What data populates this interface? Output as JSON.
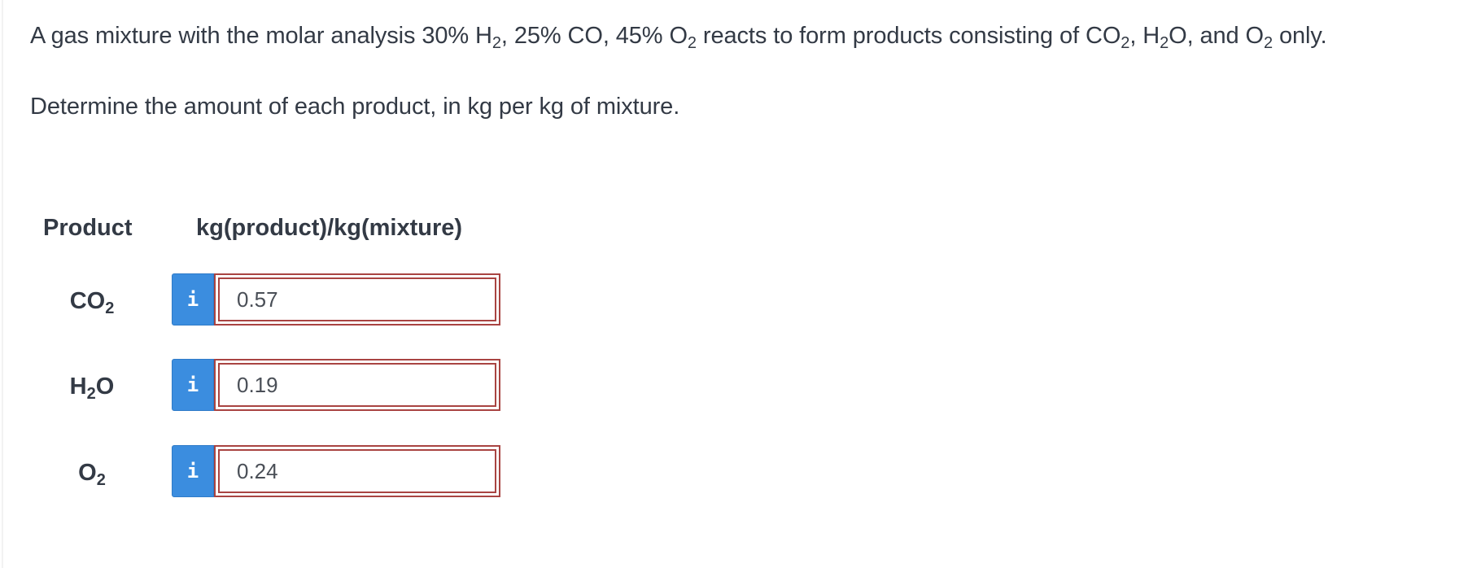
{
  "question": {
    "line1": {
      "intro": "A gas mixture with the molar analysis 30% H",
      "h2_sub": "2",
      "after_h2": ", 25% CO, 45% O",
      "o2_sub": "2",
      "after_o2": " reacts to form products consisting of CO",
      "co2_sub": "2",
      "after_co2": ", H",
      "h2o_sub": "2",
      "after_h2o": "O, and O",
      "o2b_sub": "2",
      "end": " only."
    },
    "line2": "Determine the amount of each product, in kg per kg of mixture."
  },
  "table": {
    "header_product": "Product",
    "header_unit": "kg(product)/kg(mixture)",
    "rows": [
      {
        "formula_main": "CO",
        "formula_sub": "2",
        "formula_tail": "",
        "info_icon": "i",
        "value": "0.57"
      },
      {
        "formula_main": "H",
        "formula_sub": "2",
        "formula_tail": "O",
        "info_icon": "i",
        "value": "0.19"
      },
      {
        "formula_main": "O",
        "formula_sub": "2",
        "formula_tail": "",
        "info_icon": "i",
        "value": "0.24"
      }
    ]
  },
  "colors": {
    "info_button": "#3b8ddf",
    "error_border": "#a94442",
    "text": "#333a45"
  }
}
